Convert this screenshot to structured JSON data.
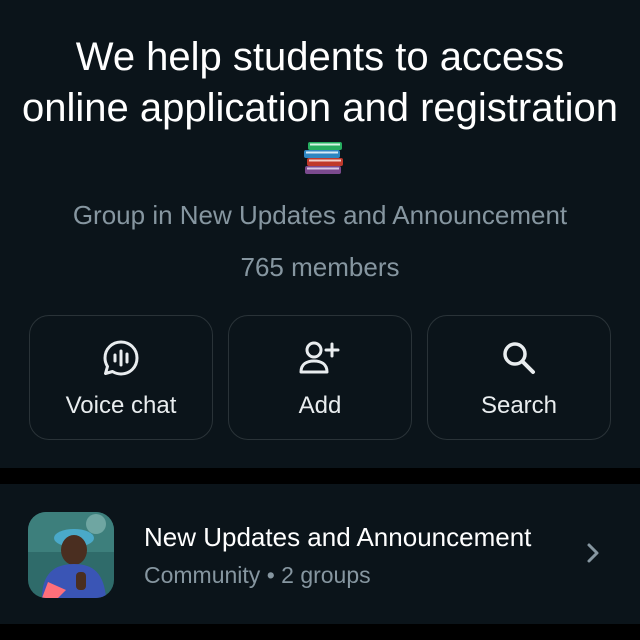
{
  "group": {
    "title": "We help students to access online application and registration",
    "title_emoji_icon": "books-icon",
    "subtitle": "Group in New Updates and Announcement",
    "members": "765 members"
  },
  "actions": [
    {
      "label": "Voice chat",
      "icon": "voice-chat-icon"
    },
    {
      "label": "Add",
      "icon": "add-person-icon"
    },
    {
      "label": "Search",
      "icon": "search-icon"
    }
  ],
  "community": {
    "name": "New Updates and Announcement",
    "meta": "Community • 2 groups",
    "chevron_icon": "chevron-right-icon"
  },
  "colors": {
    "background": "#0b141a",
    "separator": "#000000",
    "primary_text": "#e9edef",
    "secondary_text": "#8696a0",
    "card_border": "#2a3338"
  }
}
